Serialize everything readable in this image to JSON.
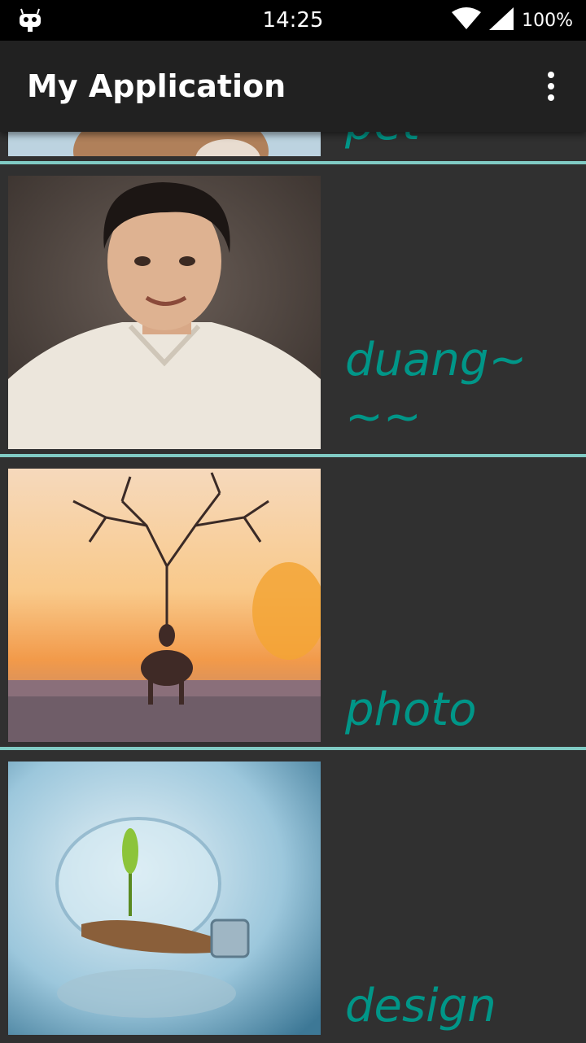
{
  "status_bar": {
    "time": "14:25",
    "battery": "100%",
    "left_icon": "cyanogenmod-icon",
    "wifi_icon": "wifi-icon",
    "signal_icon": "signal-icon"
  },
  "app_bar": {
    "title": "My Application",
    "overflow_icon": "more-vert-icon"
  },
  "list": {
    "items": [
      {
        "label": "pet",
        "image": "pet-photo"
      },
      {
        "label": "duang~~~",
        "image": "portrait-photo"
      },
      {
        "label": "photo",
        "image": "deer-tree-photo"
      },
      {
        "label": "design",
        "image": "lightbulb-plant-photo"
      }
    ]
  },
  "colors": {
    "accent": "#009688",
    "divider": "#80cbc4",
    "background": "#303030",
    "app_bar": "#212121"
  }
}
